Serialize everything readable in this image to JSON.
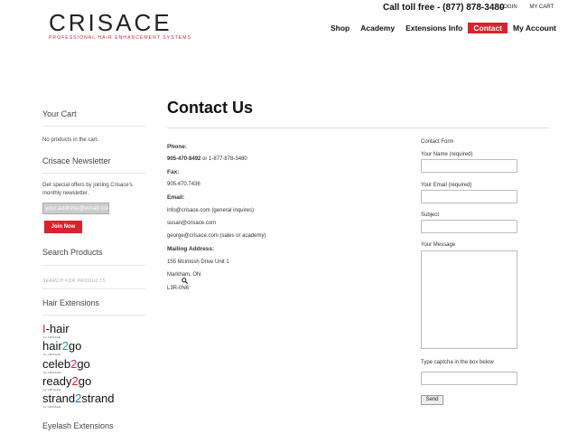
{
  "header": {
    "logo_text": "CRISACE",
    "logo_tagline": "PROFESSIONAL HAIR ENHANCEMENT SYSTEMS",
    "toll_free": "Call toll free - (877) 878-3480",
    "top_links": [
      "LOGIN",
      "MY CART"
    ],
    "nav": [
      "Shop",
      "Academy",
      "Extensions Info",
      "Contact",
      "My Account"
    ],
    "active_nav": "Contact"
  },
  "sidebar": {
    "cart_heading": "Your Cart",
    "cart_text": "No products in the cart.",
    "newsletter_heading": "Crisace Newsletter",
    "newsletter_text": "Get special offers by joining Crisace's monthly newsletter.",
    "newsletter_placeholder": "your.address@email.com",
    "join_label": "Join Now",
    "search_heading": "Search Products",
    "search_placeholder": "SEARCH FOR PRODUCTS",
    "extensions_heading": "Hair Extensions",
    "brands": [
      {
        "a": "I",
        "b": "-hair",
        "c": ""
      },
      {
        "a": "hair",
        "b": "2",
        "c": "go"
      },
      {
        "a": "celeb",
        "b": "2",
        "c": "go"
      },
      {
        "a": "ready",
        "b": "2",
        "c": "go"
      },
      {
        "a": "strand",
        "b": "2",
        "c": "strand"
      }
    ],
    "brand_sub": "by CRISACE",
    "eyelash_heading": "Eyelash Extensions"
  },
  "main": {
    "title": "Contact Us",
    "phone_label": "Phone:",
    "phone_link": "905-470-8492",
    "phone_rest": " or 1-877-878-3480",
    "fax_label": "Fax:",
    "fax": "905.470.7436",
    "email_label": "Email:",
    "email_general": "info@crisace.com (general inquires)",
    "email_susan": "susan@crisace.com",
    "email_george": "george@crisace.com (sales or academy)",
    "mailing_label": "Mailing Address:",
    "address_line1": "155 Mcintosh Drive Unit 1",
    "address_line2": "Markham, ON",
    "address_line3": "L3R-0N6"
  },
  "form": {
    "title": "Contact Form",
    "name_label": "Your Name (required)",
    "email_label": "Your Email (required)",
    "subject_label": "Subject",
    "message_label": "Your Message",
    "captcha_label": "Type captcha in the box below",
    "send_label": "Send"
  },
  "colors": {
    "accent": "#d9232d"
  }
}
